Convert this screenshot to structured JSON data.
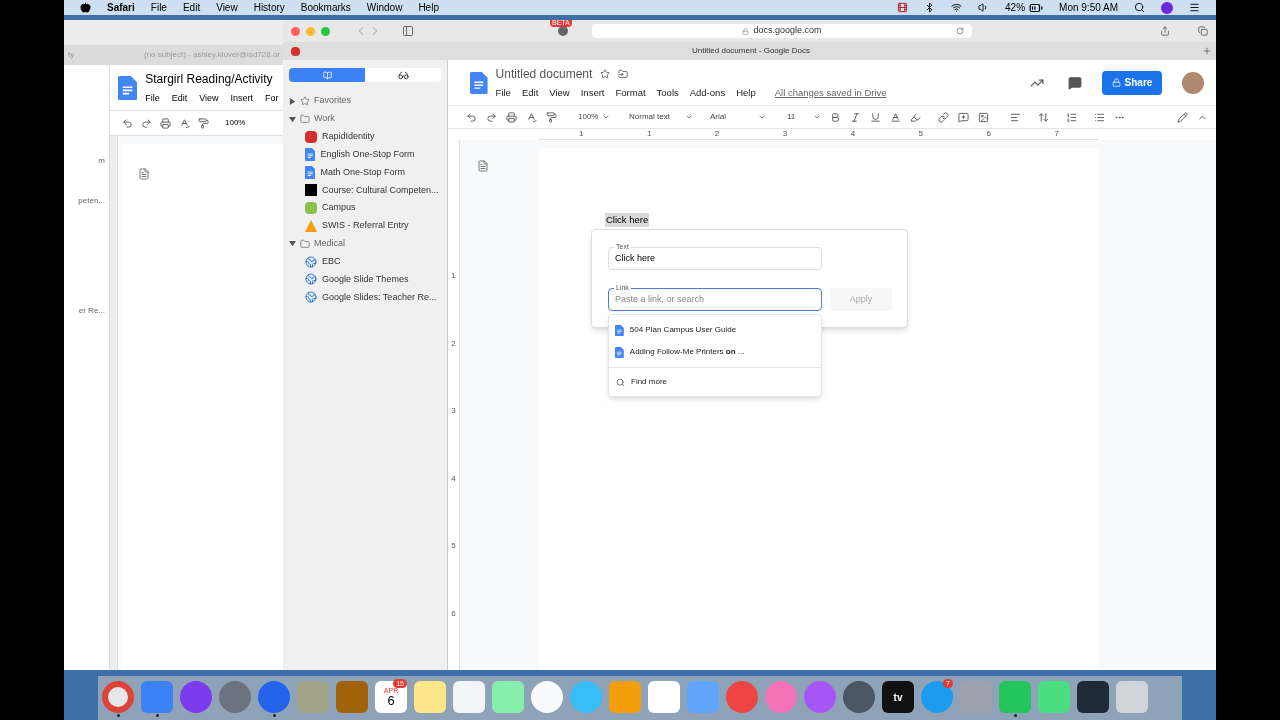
{
  "menu_bar": {
    "app": "Safari",
    "menus": [
      "File",
      "Edit",
      "View",
      "History",
      "Bookmarks",
      "Window",
      "Help"
    ],
    "battery": "42%",
    "clock": "Mon 9:50 AM"
  },
  "background_window": {
    "tabs": [
      "ty",
      "(no subject) - ashley.kluver@isd728.or"
    ],
    "doc_title": "Stargirl Reading/Activity",
    "menus": [
      "File",
      "Edit",
      "View",
      "Insert",
      "For"
    ],
    "zoom": "100%",
    "fragments": [
      "m",
      "peten...",
      "er Re..."
    ]
  },
  "browser": {
    "beta": "BETA",
    "url": "docs.google.com",
    "tab_title": "Untitled document - Google Docs",
    "sidebar": [
      {
        "label": "Favorites",
        "expanded": false
      },
      {
        "label": "Work",
        "expanded": true,
        "children": [
          {
            "label": "RapidIdentity",
            "kind": "rapid"
          },
          {
            "label": "English One-Stop Form",
            "kind": "doc"
          },
          {
            "label": "Math One-Stop Form",
            "kind": "doc"
          },
          {
            "label": "Course: Cultural Competen...",
            "kind": "course"
          },
          {
            "label": "Campus",
            "kind": "campus"
          },
          {
            "label": "SWIS - Referral Entry",
            "kind": "swis"
          }
        ]
      },
      {
        "label": "Medical",
        "expanded": true,
        "children": [
          {
            "label": "EBC",
            "kind": "globe"
          },
          {
            "label": "Google Slide Themes",
            "kind": "globe"
          },
          {
            "label": "Google Slides: Teacher Re...",
            "kind": "globe"
          }
        ]
      }
    ]
  },
  "docs": {
    "title": "Untitled document",
    "menus": [
      "File",
      "Edit",
      "View",
      "Insert",
      "Format",
      "Tools",
      "Add-ons",
      "Help"
    ],
    "saved": "All changes saved in Drive",
    "share": "Share",
    "zoom": "100%",
    "style": "Normal text",
    "font": "Arial",
    "size": "11",
    "ruler": [
      "1",
      "1",
      "2",
      "3",
      "4",
      "5",
      "6",
      "7"
    ],
    "vruler": [
      "1",
      "2",
      "3",
      "4",
      "5",
      "6"
    ],
    "selected_text": "Click here",
    "link_dialog": {
      "text_label": "Text",
      "text_value": "Click here",
      "link_label": "Link",
      "link_placeholder": "Paste a link, or search",
      "apply": "Apply",
      "apply_disabled": true,
      "suggestions": [
        "504 Plan Campus User Guide",
        "Adding Follow-Me Printers **on** ..."
      ],
      "find_more": "Find more"
    }
  },
  "dock": [
    {
      "color": "#e5e7eb",
      "kind": "chrome",
      "running": true
    },
    {
      "color": "#3b82f6",
      "kind": "app",
      "running": true
    },
    {
      "color": "#7c3aed",
      "kind": "round",
      "running": false
    },
    {
      "color": "#6b7280",
      "kind": "round",
      "running": false
    },
    {
      "color": "#2563eb",
      "kind": "round",
      "running": true
    },
    {
      "color": "#a3a38a",
      "kind": "app",
      "running": false
    },
    {
      "color": "#a16207",
      "kind": "app",
      "running": false
    },
    {
      "color": "#ffffff",
      "kind": "calendar",
      "month": "APR",
      "day": "6",
      "badge": "15",
      "running": false
    },
    {
      "color": "#fde68a",
      "kind": "app",
      "running": false
    },
    {
      "color": "#f3f4f6",
      "kind": "app",
      "running": false
    },
    {
      "color": "#86efac",
      "kind": "app",
      "running": false
    },
    {
      "color": "#f9fafb",
      "kind": "round",
      "running": false
    },
    {
      "color": "#38bdf8",
      "kind": "round",
      "running": false
    },
    {
      "color": "#f59e0b",
      "kind": "app",
      "running": false
    },
    {
      "color": "#ffffff",
      "kind": "app",
      "running": false
    },
    {
      "color": "#60a5fa",
      "kind": "app",
      "running": false
    },
    {
      "color": "#ef4444",
      "kind": "round",
      "running": false
    },
    {
      "color": "#f472b6",
      "kind": "round",
      "running": false
    },
    {
      "color": "#a855f7",
      "kind": "round",
      "running": false
    },
    {
      "color": "#4b5563",
      "kind": "round",
      "running": false
    },
    {
      "color": "#111111",
      "kind": "tv",
      "label": "tv",
      "running": false
    },
    {
      "color": "#1d9bf0",
      "kind": "round",
      "badge": "7",
      "running": false
    },
    {
      "color": "#9ca3af",
      "kind": "app",
      "running": false
    },
    {
      "color": "#22c55e",
      "kind": "app",
      "running": true
    },
    {
      "color": "#4ade80",
      "kind": "app",
      "running": false
    },
    {
      "color": "#1f2937",
      "kind": "app",
      "running": false
    },
    {
      "color": "#d1d5db",
      "kind": "app",
      "running": false
    }
  ]
}
